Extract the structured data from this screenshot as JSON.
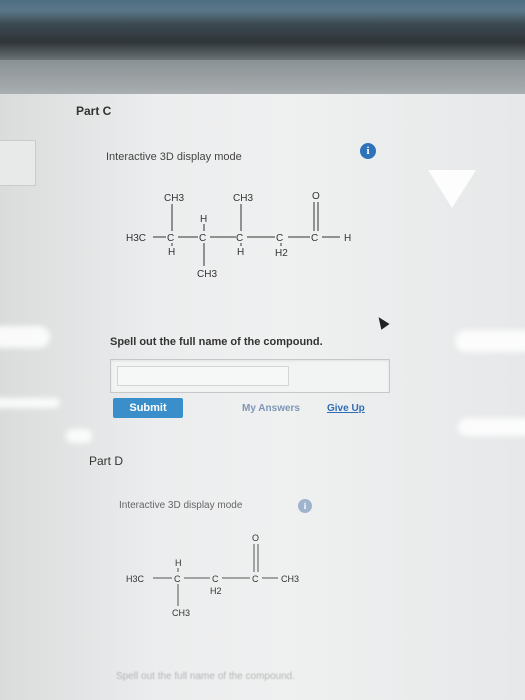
{
  "part_c": {
    "label": "Part C",
    "mode_label": "Interactive 3D display mode",
    "info_icon_glyph": "i",
    "structure": {
      "ch3_top_left": "CH3",
      "ch3_top_right": "CH3",
      "h3c_left": "H3C",
      "c1": "C",
      "h_below_c1": "H",
      "h_above_c2": "H",
      "c2": "C",
      "c3": "C",
      "h_below_c3": "H",
      "c4": "C",
      "h2_below_c4": "H2",
      "c5": "C",
      "o_top": "O",
      "h_right": "H",
      "ch3_bottom": "CH3"
    },
    "question": "Spell out the full name of the compound.",
    "answer_value": "",
    "submit_label": "Submit",
    "my_answers_label": "My Answers",
    "give_up_label": "Give Up"
  },
  "part_d": {
    "label": "Part D",
    "mode_label": "Interactive 3D display mode",
    "structure": {
      "h3c_left": "H3C",
      "h_above_c1": "H",
      "c1": "C",
      "c2": "C",
      "h2_below_c2": "H2",
      "c3": "C",
      "o_top": "O",
      "ch3_right": "CH3",
      "ch3_bottom": "CH3"
    },
    "question_partial": "Spell out the full name of the compound."
  },
  "colors": {
    "accent": "#2e73b9",
    "submit_bg": "#3a8fca",
    "link": "#2f6db5"
  }
}
